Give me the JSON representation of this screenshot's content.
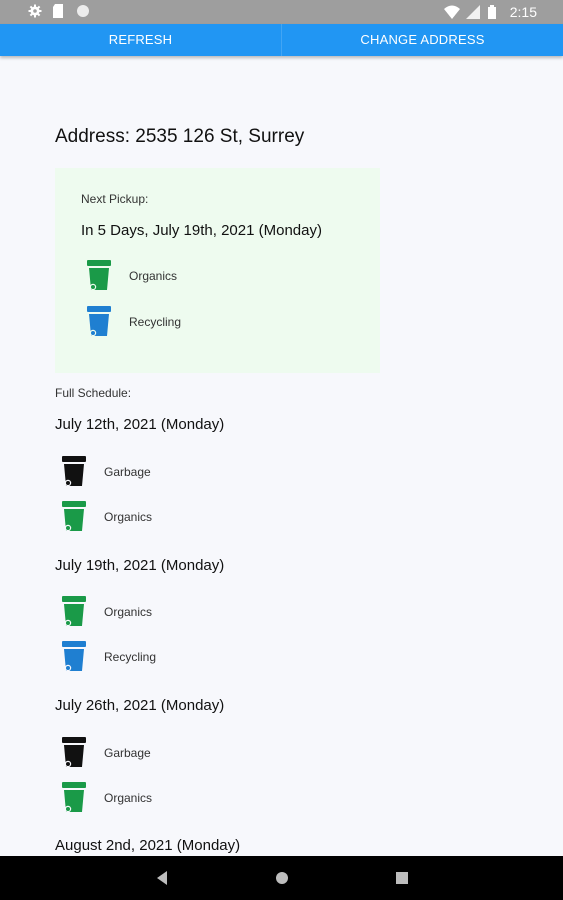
{
  "status_bar": {
    "time": "2:15"
  },
  "toolbar": {
    "refresh_label": "REFRESH",
    "change_address_label": "CHANGE ADDRESS"
  },
  "colors": {
    "toolbar": "#2196f3",
    "organics": "#1a9a48",
    "recycling": "#1f7fd1",
    "garbage": "#111111",
    "card_bg": "#eefbef"
  },
  "address": {
    "text": "Address: 2535 126 St, Surrey"
  },
  "next_pickup": {
    "label": "Next Pickup:",
    "date": "In 5 Days, July 19th, 2021 (Monday)",
    "bins": [
      {
        "type": "Organics",
        "icon": "organics-bin-icon"
      },
      {
        "type": "Recycling",
        "icon": "recycling-bin-icon"
      }
    ]
  },
  "full_schedule": {
    "label": "Full Schedule:",
    "entries": [
      {
        "date": "July 12th, 2021 (Monday)",
        "bins": [
          "Garbage",
          "Organics"
        ]
      },
      {
        "date": "July 19th, 2021 (Monday)",
        "bins": [
          "Organics",
          "Recycling"
        ]
      },
      {
        "date": "July 26th, 2021 (Monday)",
        "bins": [
          "Garbage",
          "Organics"
        ]
      },
      {
        "date": "August 2nd, 2021 (Monday)",
        "bins": []
      }
    ]
  }
}
